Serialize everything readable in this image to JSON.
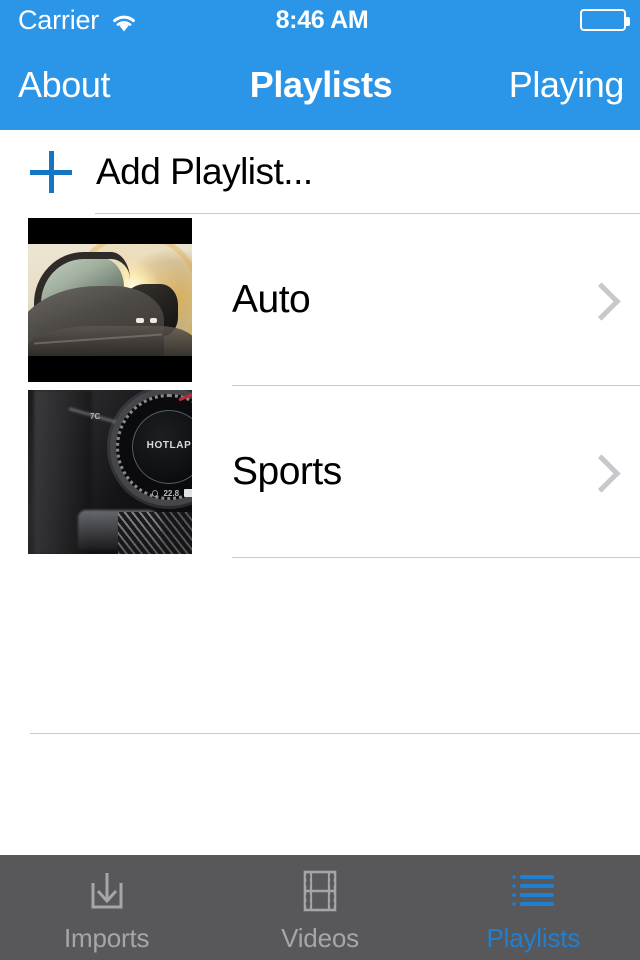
{
  "status_bar": {
    "carrier": "Carrier",
    "wifi_icon": "wifi-icon",
    "time": "8:46 AM",
    "battery_icon": "battery-full-icon"
  },
  "nav_bar": {
    "left_button": "About",
    "title": "Playlists",
    "right_button": "Playing",
    "background_color": "#2b95e8",
    "text_color": "#ffffff"
  },
  "main": {
    "add_row": {
      "icon": "plus-icon",
      "label": "Add Playlist...",
      "icon_color": "#1577c4"
    },
    "playlists": [
      {
        "title": "Auto",
        "thumbnail": "car-sunset-thumbnail",
        "disclosure_icon": "chevron-right-icon"
      },
      {
        "title": "Sports",
        "thumbnail": "dashboard-gauge-hotlap-thumbnail",
        "disclosure_icon": "chevron-right-icon",
        "thumbnail_text": "HOTLAP"
      }
    ],
    "separator_color": "#c8c7cc"
  },
  "tab_bar": {
    "background_color": "#58585a",
    "inactive_color": "#a6a6a8",
    "active_color": "#1f7fd0",
    "tabs": [
      {
        "label": "Imports",
        "icon": "download-tray-icon",
        "active": false
      },
      {
        "label": "Videos",
        "icon": "film-strip-icon",
        "active": false
      },
      {
        "label": "Playlists",
        "icon": "bulleted-list-icon",
        "active": true
      }
    ]
  }
}
